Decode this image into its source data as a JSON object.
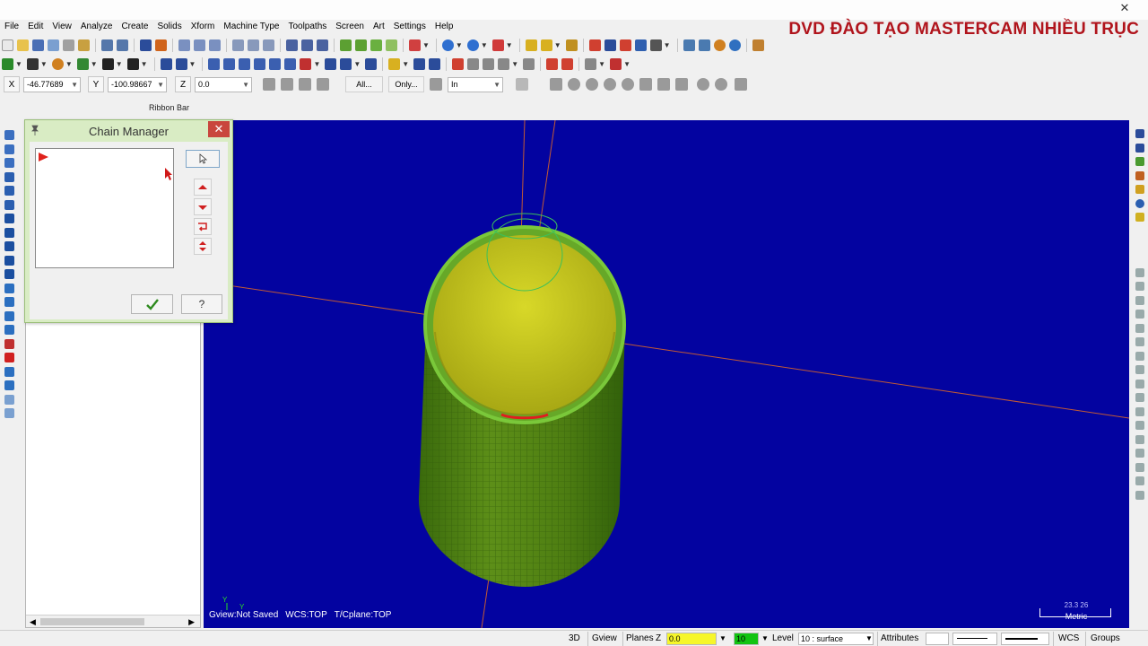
{
  "brand": "DVD ĐÀO TẠO MASTERCAM NHIỀU TRỤC",
  "menu": [
    "File",
    "Edit",
    "View",
    "Analyze",
    "Create",
    "Solids",
    "Xform",
    "Machine Type",
    "Toolpaths",
    "Screen",
    "Art",
    "Settings",
    "Help"
  ],
  "ribbon": {
    "x_label": "X",
    "x_value": "-46.77689",
    "y_label": "Y",
    "y_value": "-100.98667",
    "z_label": "Z",
    "z_value": "0.0",
    "all_button": "All...",
    "only_button": "Only...",
    "units_value": "In",
    "caption": "Ribbon Bar"
  },
  "chain_manager": {
    "title": "Chain Manager",
    "close_glyph": "✕",
    "help_glyph": "?"
  },
  "viewport": {
    "gview": "Gview:Not Saved",
    "wcs": "WCS:TOP",
    "tcplane": "T/Cplane:TOP",
    "scale_value": "23.3 26",
    "scale_units": "Metric",
    "background_color": "#0303a0",
    "cylinder_color": "#5a8a14",
    "inner_color": "#c8c81c"
  },
  "statusbar": {
    "mode_3d": "3D",
    "gview": "Gview",
    "planes": "Planes",
    "z_label": "Z",
    "z_value": "0.0",
    "color_value": "10",
    "level_label": "Level",
    "level_value": "10 : surface",
    "attributes": "Attributes",
    "wcs": "WCS",
    "groups": "Groups"
  }
}
